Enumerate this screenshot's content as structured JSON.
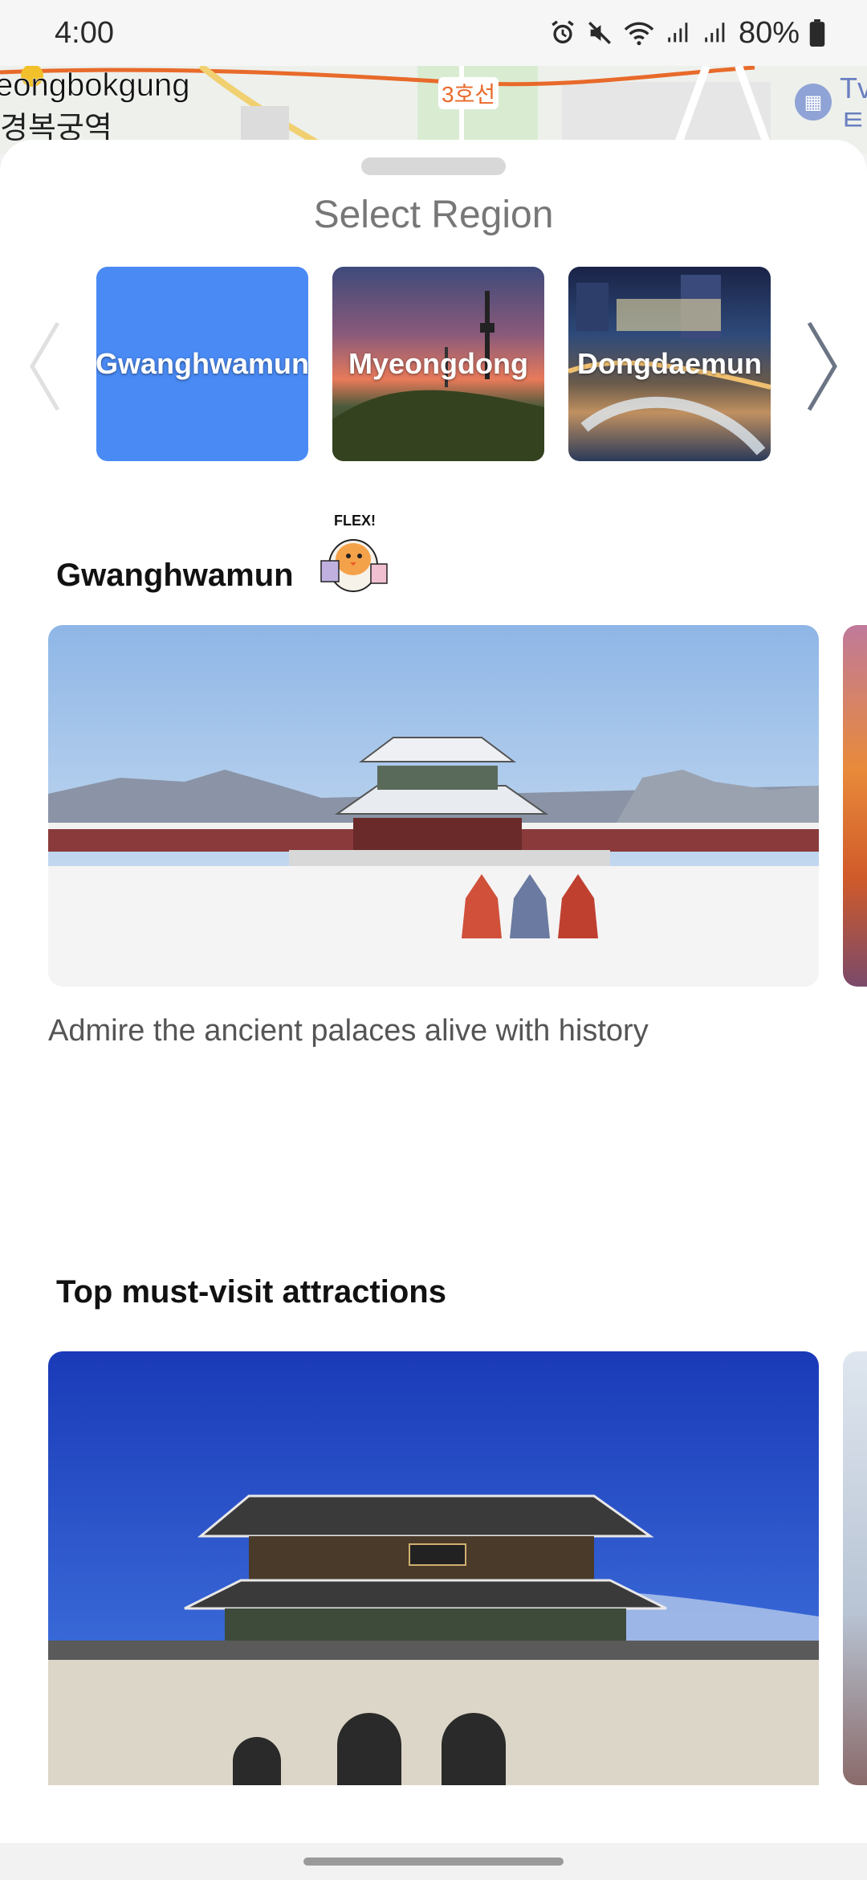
{
  "status_bar": {
    "time": "4:00",
    "battery": "80%",
    "icons": [
      "alarm-icon",
      "mute-icon",
      "wifi-icon",
      "signal-icon",
      "signal-icon",
      "battery-icon"
    ]
  },
  "map": {
    "label_en": "eongbokgung",
    "label_ko": "경복궁역",
    "line_label": "3호선",
    "poi_text": "Tv\nㅌ"
  },
  "sheet": {
    "title": "Select Region"
  },
  "regions": [
    {
      "label": "Gwanghwamun",
      "selected": true
    },
    {
      "label": "Myeongdong",
      "selected": false
    },
    {
      "label": "Dongdaemun",
      "selected": false
    }
  ],
  "section": {
    "region_title": "Gwanghwamun",
    "mascot_text": "FLEX!",
    "description": "Admire the ancient palaces alive with history",
    "attractions_title": "Top must-visit attractions"
  },
  "colors": {
    "accent": "#4a8af4",
    "text_primary": "#111111",
    "text_secondary": "#555555"
  }
}
